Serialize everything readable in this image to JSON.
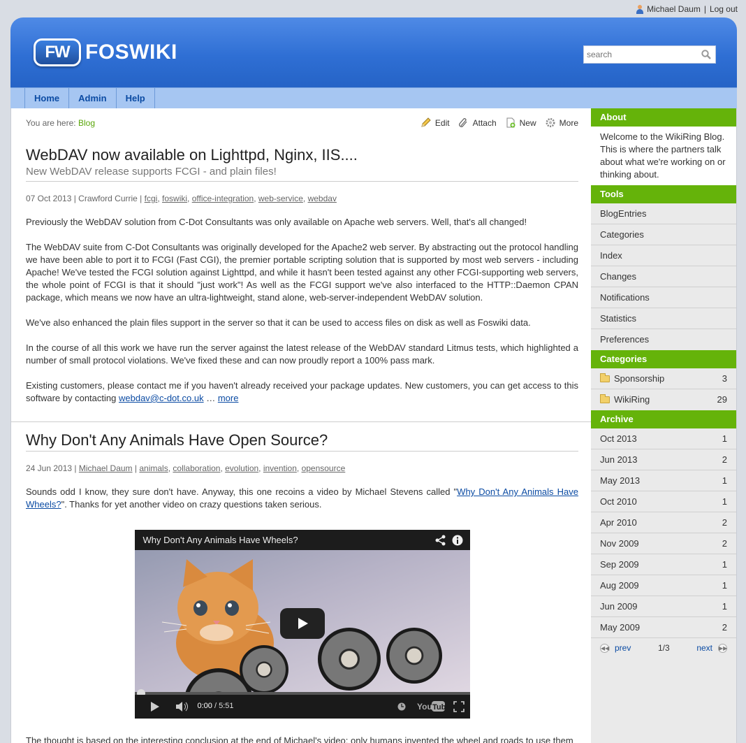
{
  "user": {
    "name": "Michael Daum",
    "separator": "|",
    "logout": "Log out"
  },
  "header": {
    "logo_badge": "FW",
    "logo_text": "FOSWIKI",
    "search_placeholder": "search"
  },
  "nav": [
    "Home",
    "Admin",
    "Help"
  ],
  "breadcrumb": {
    "prefix": "You are here:",
    "link": "Blog"
  },
  "actions": [
    "Edit",
    "Attach",
    "New",
    "More"
  ],
  "post1": {
    "title": "WebDAV now available on Lighttpd, Nginx, IIS....",
    "subtitle": "New WebDAV release supports FCGI - and plain files!",
    "date_author": "07 Oct 2013 | Crawford Currie |",
    "tags": [
      "fcgi",
      "foswiki",
      "office-integration",
      "web-service",
      "webdav"
    ],
    "p1": "Previously the WebDAV solution from C-Dot Consultants was only available on Apache web servers. Well, that's all changed!",
    "p2": "The WebDAV suite from C-Dot Consultants was originally developed for the Apache2 web server. By abstracting out the protocol handling we have been able to port it to FCGI (Fast CGI), the premier portable scripting solution that is supported by most web servers - including Apache! We've tested the FCGI solution against Lighttpd, and while it hasn't been tested against any other FCGI-supporting web servers, the whole point of FCGI is that it should \"just work\"! As well as the FCGI support we've also interfaced to the HTTP::Daemon CPAN package, which means we now have an ultra-lightweight, stand alone, web-server-independent WebDAV solution.",
    "p3": "We've also enhanced the plain files support in the server so that it can be used to access files on disk as well as Foswiki data.",
    "p4": "In the course of all this work we have run the server against the latest release of the WebDAV standard Litmus tests, which highlighted a number of small protocol violations. We've fixed these and can now proudly report a 100% pass mark.",
    "p5": "Existing customers, please contact me if you haven't already received your package updates. New customers, you can get access to this software by contacting",
    "email": "webdav@c-dot.co.uk",
    "ellipsis": "…",
    "more": "more"
  },
  "post2": {
    "title": "Why Don't Any Animals Have Open Source?",
    "date": "24 Jun 2013 |",
    "author": "Michael Daum",
    "author_sep": "|",
    "tags": [
      "animals",
      "collaboration",
      "evolution",
      "invention",
      "opensource"
    ],
    "p1_start": "Sounds odd I know, they sure don't have. Anyway, this one recoins a video by Michael Stevens called \"",
    "p1_link": "Why Don't Any Animals Have Wheels?",
    "p1_end": "\". Thanks for yet another video on crazy questions taken serious.",
    "video_title": "Why Don't Any Animals Have Wheels?",
    "video_time_current": "0:00",
    "video_time_total": "/ 5:51",
    "video_progress": 0,
    "p2": "The thought is based on the interesting conclusion at the end of Michael's video: only humans invented the wheel and roads to use them"
  },
  "sidebar": {
    "about_title": "About",
    "about_text": "Welcome to the WikiRing Blog. This is where the partners talk about what we're working on or thinking about.",
    "tools_title": "Tools",
    "tools": [
      "BlogEntries",
      "Categories",
      "Index",
      "Changes",
      "Notifications",
      "Statistics",
      "Preferences"
    ],
    "categories_title": "Categories",
    "categories": [
      {
        "name": "Sponsorship",
        "count": "3"
      },
      {
        "name": "WikiRing",
        "count": "29"
      }
    ],
    "archive_title": "Archive",
    "archive": [
      {
        "month": "Oct 2013",
        "count": "1"
      },
      {
        "month": "Jun 2013",
        "count": "2"
      },
      {
        "month": "May 2013",
        "count": "1"
      },
      {
        "month": "Oct 2010",
        "count": "1"
      },
      {
        "month": "Apr 2010",
        "count": "2"
      },
      {
        "month": "Nov 2009",
        "count": "2"
      },
      {
        "month": "Sep 2009",
        "count": "1"
      },
      {
        "month": "Aug 2009",
        "count": "1"
      },
      {
        "month": "Jun 2009",
        "count": "1"
      },
      {
        "month": "May 2009",
        "count": "2"
      }
    ],
    "pager": {
      "prev": "prev",
      "page": "1/3",
      "next": "next"
    }
  },
  "colors": {
    "brand_blue": "#2f6fd4",
    "nav": "#a6c6f2",
    "sidebar_head": "#65b30a",
    "link": "#0b4ba3"
  }
}
